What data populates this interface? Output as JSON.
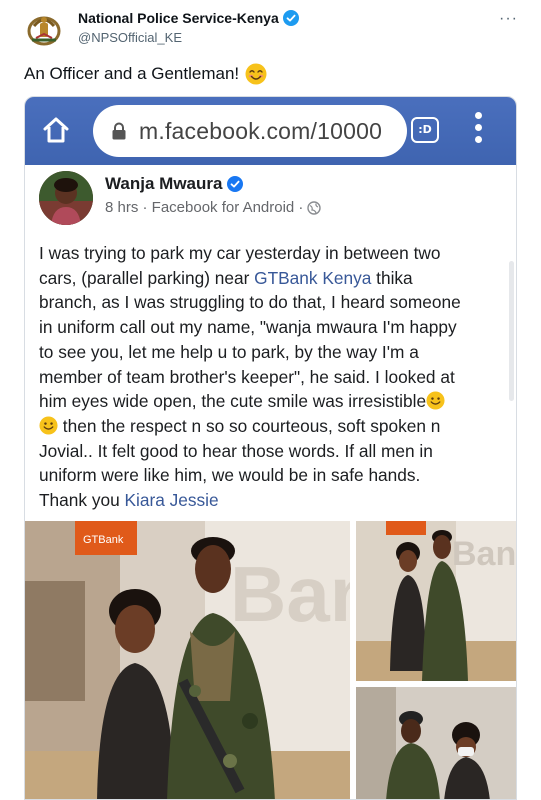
{
  "tweet": {
    "account_name": "National Police Service-Kenya",
    "handle": "@NPSOfficial_KE",
    "more_label": "···",
    "text": "An Officer and a Gentleman!",
    "text_emoji": "smiling-face-emoji"
  },
  "browser": {
    "url": "m.facebook.com/10000",
    "tabs_label": ":D",
    "bar_color": "#4267b2",
    "icons": [
      "home-icon",
      "lock-icon",
      "tabs-icon",
      "overflow-menu-icon"
    ]
  },
  "post": {
    "author": "Wanja Mwaura",
    "meta": "8 hrs · Facebook for Android ·",
    "lines": {
      "l1": "I was trying to park my car yesterday in between two",
      "l2a": "cars, (parallel parking) near ",
      "l2link": "GTBank Kenya",
      "l2b": " thika",
      "l3": "branch, as I was struggling to do that, I heard someone",
      "l4": "in uniform call out my name, \"wanja mwaura I'm happy",
      "l5": "to see you, let me help u to park, by the way I'm a",
      "l6": "member of team brother's keeper\", he said. I looked at",
      "l7": "him eyes wide open, the cute smile was irresistible",
      "l8": " then the respect n so so courteous, soft spoken n",
      "l9": "Jovial.. It felt good to hear those words. If all men in",
      "l10": "uniform were like him, we would be in safe hands.",
      "l11a": "Thank you ",
      "l11link": "Kiara Jessie"
    },
    "photo_sign_text": "GTBank",
    "wall_letters_main": "Ban",
    "wall_letters_small": "Banl",
    "link_color": "#385898"
  }
}
